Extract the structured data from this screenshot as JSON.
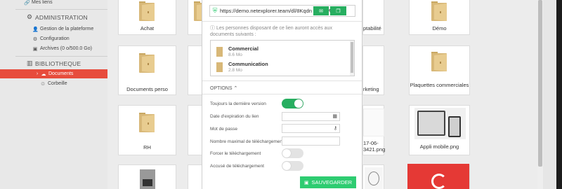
{
  "sidebar": {
    "my_links": "Mes liens",
    "admin_section": "ADMINISTRATION",
    "admin_items": [
      "Gestion de la plateforme",
      "Configuration",
      "Archives (0 o/500.0 Go)"
    ],
    "library_section": "BIBLIOTHEQUE",
    "documents": "Documents",
    "trash": "Corbeille"
  },
  "tiles": {
    "row1": [
      "Achat",
      "",
      "...omptabilité",
      "Démo"
    ],
    "row2": [
      "Documents perso",
      "",
      "...rketing",
      "Plaquettes commerciales"
    ],
    "row3": [
      "RH",
      "",
      "17-06-...3421.png",
      "Appli mobile.png"
    ]
  },
  "modal": {
    "url": "https://demo.netexplorer.team/dl/8Kqdn",
    "url_suffix": "₹",
    "info": "Les personnes disposant de ce lien auront accès aux documents suivants :",
    "files": [
      {
        "name": "Commercial",
        "size": "8.6 Mo"
      },
      {
        "name": "Communication",
        "size": "2.8 Mo"
      }
    ],
    "options_label": "OPTIONS",
    "options": {
      "always_latest": "Toujours la dernière version",
      "expiry": "Date d'expiration du lien",
      "password": "Mot de passe",
      "max_downloads": "Nombre maximal de téléchargements",
      "force_download": "Forcer le téléchargement",
      "download_receipt": "Accusé de téléchargement"
    },
    "toggles": {
      "always_latest": true,
      "force_download": false,
      "download_receipt": false
    },
    "save_label": "SAUVEGARDER"
  },
  "colors": {
    "accent_red": "#e74c3c",
    "accent_green": "#27ae60"
  }
}
